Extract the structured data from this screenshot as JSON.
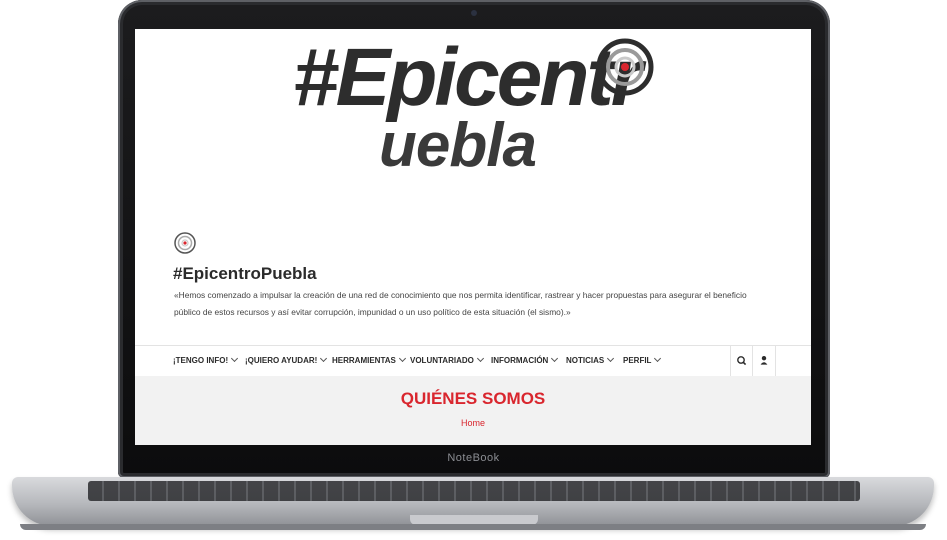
{
  "device": {
    "brand_label": "NoteBook"
  },
  "logo": {
    "line1": "#Epicentr",
    "line2": "uebla"
  },
  "site": {
    "title": "#EpicentroPuebla",
    "description": "«Hemos comenzado a impulsar la creación de una red de conocimiento que nos permita identificar, rastrear y hacer propuestas para asegurar el beneficio público de estos recursos y así evitar corrupción, impunidad o un uso político de esta situación (el sismo).»"
  },
  "nav": {
    "items": [
      {
        "label": "¡TENGO INFO!"
      },
      {
        "label": "¡QUIERO AYUDAR!"
      },
      {
        "label": "HERRAMIENTAS"
      },
      {
        "label": "VOLUNTARIADO"
      },
      {
        "label": "INFORMACIÓN"
      },
      {
        "label": "NOTICIAS"
      },
      {
        "label": "PERFIL"
      }
    ],
    "icons": [
      "search-icon",
      "user-icon"
    ]
  },
  "hero": {
    "title": "QUIÉNES SOMOS",
    "breadcrumb": "Home"
  },
  "colors": {
    "accent": "#d9262e",
    "text": "#2b2b2b",
    "hero_bg": "#f2f2f2"
  }
}
